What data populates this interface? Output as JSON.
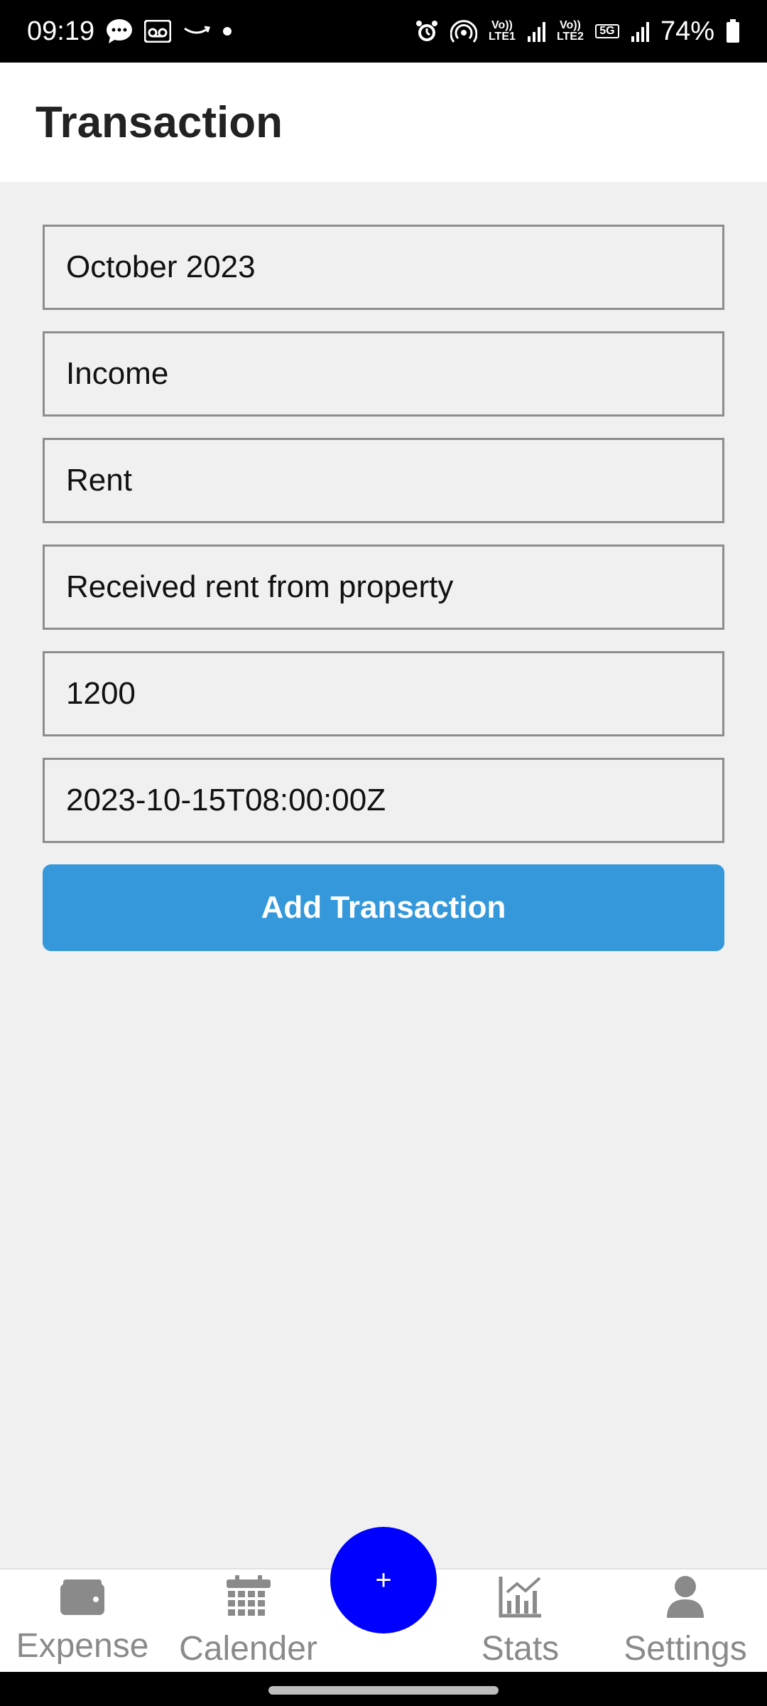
{
  "status_bar": {
    "time": "09:19",
    "battery": "74%",
    "sim1_label": "Vo)) LTE1",
    "sim2_label": "Vo)) LTE2",
    "network_label": "5G"
  },
  "header": {
    "title": "Transaction"
  },
  "form": {
    "month": "October 2023",
    "type": "Income",
    "category": "Rent",
    "description": "Received rent from property",
    "amount": "1200",
    "datetime": "2023-10-15T08:00:00Z",
    "submit_label": "Add Transaction"
  },
  "bottom_nav": {
    "items": [
      {
        "label": "Expense",
        "icon": "wallet-icon"
      },
      {
        "label": "Calender",
        "icon": "calendar-icon"
      },
      {
        "label": "Stats",
        "icon": "stats-icon"
      },
      {
        "label": "Settings",
        "icon": "user-icon"
      }
    ],
    "fab_label": "+"
  },
  "colors": {
    "primary_button": "#3498db",
    "fab": "#0000ff",
    "nav_inactive": "#8a8a8a"
  }
}
